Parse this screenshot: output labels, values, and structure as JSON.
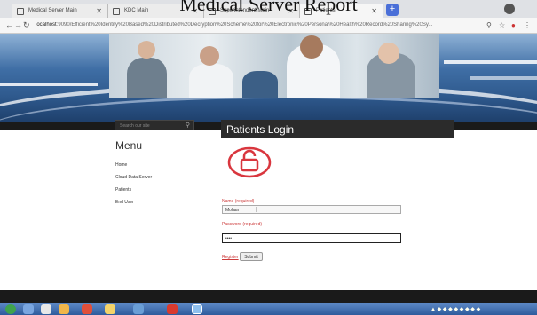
{
  "overlay_title": "Medical Server Report",
  "browser": {
    "tabs": [
      {
        "label": "Medical Server Main"
      },
      {
        "label": "KDC Main"
      },
      {
        "label": "Superintendent Main"
      },
      {
        "label": "Patients"
      }
    ],
    "url_host": "localhost",
    "url_rest": ":9090/Efficient%20Identity%20Based%20Distributed%20Decryption%20Scheme%20for%20Electronic%20Personal%20Health%20Record%20Sharing%20Sy..."
  },
  "sidebar": {
    "search_placeholder": "Search our site",
    "menu_title": "Menu",
    "items": [
      {
        "label": "Home"
      },
      {
        "label": "Cloud Data Server"
      },
      {
        "label": "Patients"
      },
      {
        "label": "End User"
      }
    ]
  },
  "login": {
    "title": "Patients Login",
    "name_label": "Name (required)",
    "name_value": "Mohan",
    "password_label": "Password (required)",
    "password_value": "••••",
    "register_label": "Register",
    "submit_label": "Submit"
  },
  "colors": {
    "accent_red": "#cc3b3b",
    "dark_band": "#1a1a1a",
    "banner_blue": "#2f5a8e"
  }
}
